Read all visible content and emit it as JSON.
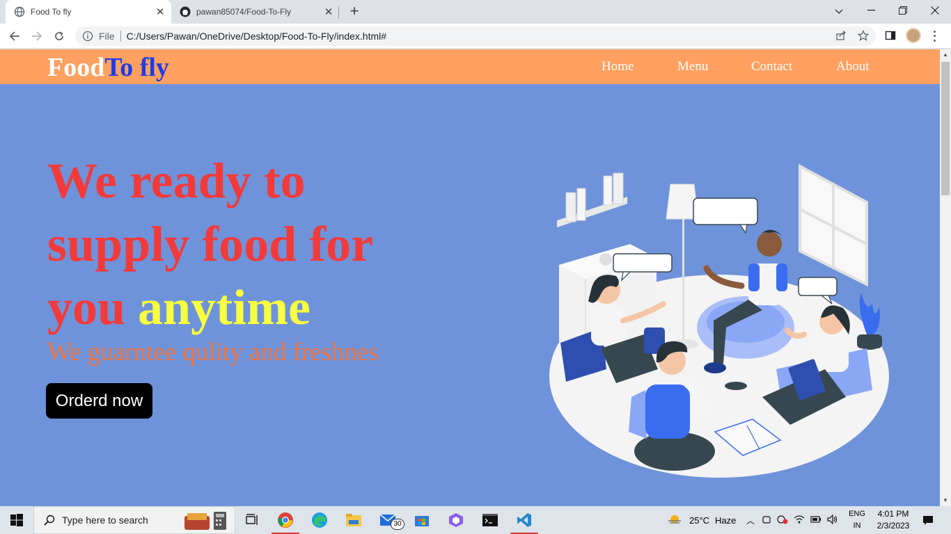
{
  "browser": {
    "tabs": [
      {
        "title": "Food To fly",
        "active": true
      },
      {
        "title": "pawan85074/Food-To-Fly",
        "active": false
      }
    ],
    "address": {
      "protocol_label": "File",
      "url": "C:/Users/Pawan/OneDrive/Desktop/Food-To-Fly/index.html#"
    }
  },
  "site": {
    "logo": {
      "part1": "Food",
      "part2": "To fly"
    },
    "nav": [
      "Home",
      "Menu",
      "Contact",
      "About"
    ],
    "hero": {
      "line1": "We ready to",
      "line2": "supply food for",
      "line3a": "you",
      "line3b": "anytime",
      "subtitle": "We guarntee qulity and freshnes",
      "button": "Orderd now"
    },
    "colors": {
      "background": "#6f93da",
      "header": "#ffa060",
      "headline": "#f23a3a",
      "highlight": "#f7ff3e",
      "subtitle": "#f0743e",
      "logo_accent": "#1e3ce6"
    }
  },
  "taskbar": {
    "search_placeholder": "Type here to search",
    "mail_badge": "30",
    "weather": {
      "temp": "25°C",
      "condition": "Haze"
    },
    "lang": {
      "line1": "ENG",
      "line2": "IN"
    },
    "clock": {
      "time": "4:01 PM",
      "date": "2/3/2023"
    }
  }
}
